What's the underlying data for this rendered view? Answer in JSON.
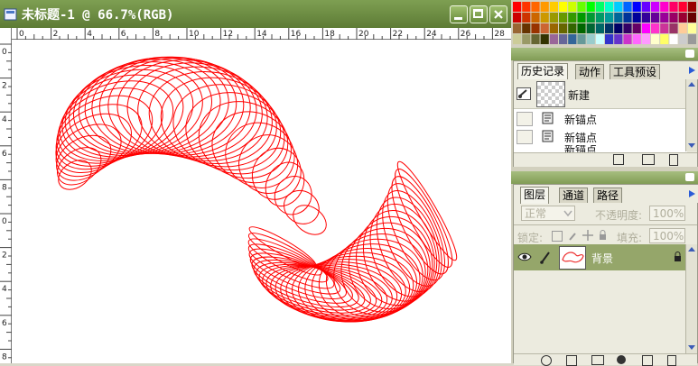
{
  "doc": {
    "title": "未标题-1 @ 66.7%(RGB)"
  },
  "ruler": {
    "top_labels": [
      "0",
      "2",
      "4",
      "6",
      "8",
      "10",
      "12",
      "14",
      "16",
      "18",
      "20",
      "22",
      "24",
      "26",
      "28"
    ],
    "left_labels": [
      "0",
      "2",
      "4",
      "6",
      "8",
      "0",
      "2",
      "4",
      "6",
      "8"
    ]
  },
  "colors": {
    "curve": "#ff0000",
    "title_bar": "#6f9043",
    "panel": "#ecebdf"
  },
  "swatches": [
    [
      "#ff0000",
      "#ff3300",
      "#ff6600",
      "#ff9900",
      "#ffcc00",
      "#ffff00",
      "#ccff00",
      "#66ff00",
      "#00ff00",
      "#00ff66",
      "#00ffcc",
      "#00ccff",
      "#0066ff",
      "#0000ff",
      "#6600ff",
      "#cc00ff",
      "#ff00cc",
      "#ff0066",
      "#ff0033",
      "#990000"
    ],
    [
      "#cc0000",
      "#cc3300",
      "#cc6600",
      "#cc9900",
      "#999900",
      "#669900",
      "#339900",
      "#009900",
      "#009933",
      "#009966",
      "#009999",
      "#006699",
      "#003399",
      "#000099",
      "#330099",
      "#660099",
      "#990099",
      "#990066",
      "#990033",
      "#660000"
    ],
    [
      "#996633",
      "#663300",
      "#993300",
      "#cc6633",
      "#996600",
      "#666600",
      "#336600",
      "#006600",
      "#006633",
      "#006666",
      "#003366",
      "#000066",
      "#330066",
      "#660066",
      "#ff00ff",
      "#ff33cc",
      "#cc3399",
      "#993366",
      "#ffcc99",
      "#ffff99"
    ],
    [
      "#cccc99",
      "#999966",
      "#666633",
      "#333300",
      "#996699",
      "#666699",
      "#336699",
      "#669999",
      "#99cccc",
      "#ccffff",
      "#3333cc",
      "#6633cc",
      "#cc33cc",
      "#ff66ff",
      "#ff99ff",
      "#ffffcc",
      "#ffff66",
      "#ffffff",
      "#cccccc",
      "#999999"
    ]
  ],
  "history": {
    "tabs": [
      "历史记录",
      "动作",
      "工具预设"
    ],
    "snapshot_label": "新建",
    "items": [
      "新锚点",
      "新锚点",
      "新锚点"
    ]
  },
  "layers": {
    "tabs": [
      "图层",
      "通道",
      "路径"
    ],
    "blend_mode": "正常",
    "opacity_label": "不透明度:",
    "opacity_value": "100%",
    "lock_label": "锁定:",
    "fill_label": "填充:",
    "fill_value": "100%",
    "layer_name": "背景"
  }
}
